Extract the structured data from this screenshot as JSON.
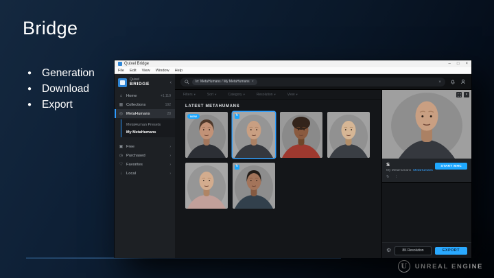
{
  "slide": {
    "title": "Bridge",
    "bullets": [
      "Generation",
      "Download",
      "Export"
    ],
    "bullet_glyph": "●",
    "footer_brand": "UNREAL ENGINE",
    "footer_logo_letter": "U",
    "accent_color": "#3f6fa5"
  },
  "window": {
    "titlebar": {
      "title": "Quixel Bridge",
      "minimize": "–",
      "maximize": "□",
      "close": "×"
    },
    "menus": [
      "File",
      "Edit",
      "View",
      "Window",
      "Help"
    ],
    "sidebar": {
      "logo_top": "Quixel",
      "logo_bottom": "BRIDGE",
      "collapse": "‹",
      "items": [
        {
          "id": "home",
          "label": "Home",
          "icon": "⌂",
          "right": "+1,119",
          "active": false
        },
        {
          "id": "collections",
          "label": "Collections",
          "icon": "▦",
          "right": "192",
          "active": false
        },
        {
          "id": "metahumans",
          "label": "MetaHumans",
          "icon": "◎",
          "right": "28",
          "active": true
        }
      ],
      "subitems": [
        {
          "id": "metahuman-presets",
          "label": "MetaHuman Presets",
          "active": false
        },
        {
          "id": "my-metahumans",
          "label": "My MetaHumans",
          "active": true
        }
      ],
      "groups": [
        {
          "id": "free",
          "label": "Free",
          "icon": "▣",
          "right": "›"
        },
        {
          "id": "purchased",
          "label": "Purchased",
          "icon": "◷",
          "right": "›"
        },
        {
          "id": "favorites",
          "label": "Favorites",
          "icon": "♡",
          "right": "›"
        },
        {
          "id": "local",
          "label": "Local",
          "icon": "↓",
          "right": "›"
        }
      ]
    },
    "topbar": {
      "search_chip": "In: MetaHumans / My MetaHumans",
      "chip_close": "×",
      "clear": "×"
    },
    "filterbar": [
      "Filters",
      "Sort",
      "Category",
      "Resolution",
      "View"
    ],
    "section_title": "LATEST METAHUMANS",
    "tiles": [
      {
        "badge": "NEW",
        "selected": false,
        "sync": false,
        "style": "short",
        "skin": "#c29277",
        "skin2": "#a2765c",
        "hair": "#4e382a",
        "top": "#2c2f35",
        "bg": "#9c9c9c"
      },
      {
        "badge": "",
        "selected": true,
        "sync": true,
        "style": "bald",
        "skin": "#c99f82",
        "skin2": "#ab8164",
        "hair": "",
        "top": "#35383e",
        "bg": "#a6a6a6"
      },
      {
        "badge": "",
        "selected": false,
        "sync": false,
        "style": "curly",
        "skin": "#8a5a3f",
        "skin2": "#6f4629",
        "hair": "#33241b",
        "top": "#9e392f",
        "bg": "#9a9a9a"
      },
      {
        "badge": "",
        "selected": false,
        "sync": false,
        "style": "bald",
        "skin": "#d6b695",
        "skin2": "#b28e69",
        "hair": "",
        "top": "#3a3e44",
        "bg": "#a2a2a2"
      },
      {
        "badge": "",
        "selected": false,
        "sync": false,
        "style": "bald",
        "skin": "#d3ac8e",
        "skin2": "#b08565",
        "hair": "",
        "top": "#c2a09a",
        "bg": "#a7a7a7"
      },
      {
        "badge": "",
        "selected": false,
        "sync": true,
        "style": "short",
        "skin": "#a3745a",
        "skin2": "#855a41",
        "hair": "#221b16",
        "top": "#32404c",
        "bg": "#9e9e9e"
      }
    ],
    "detail": {
      "name": "S",
      "subtitle": "My MetaHumans",
      "subtitle_link": "MetaHumans",
      "button": "START MHC",
      "actions": [
        "↻",
        "⋮"
      ],
      "portrait": {
        "style": "bald",
        "skin": "#c99f82",
        "skin2": "#ab8164",
        "hair": "",
        "top": "#35383e",
        "bg": "#9f9f9f"
      },
      "resolution": "8K Resolution",
      "export": "EXPORT",
      "accent_blue": "#1ea7fd"
    }
  }
}
